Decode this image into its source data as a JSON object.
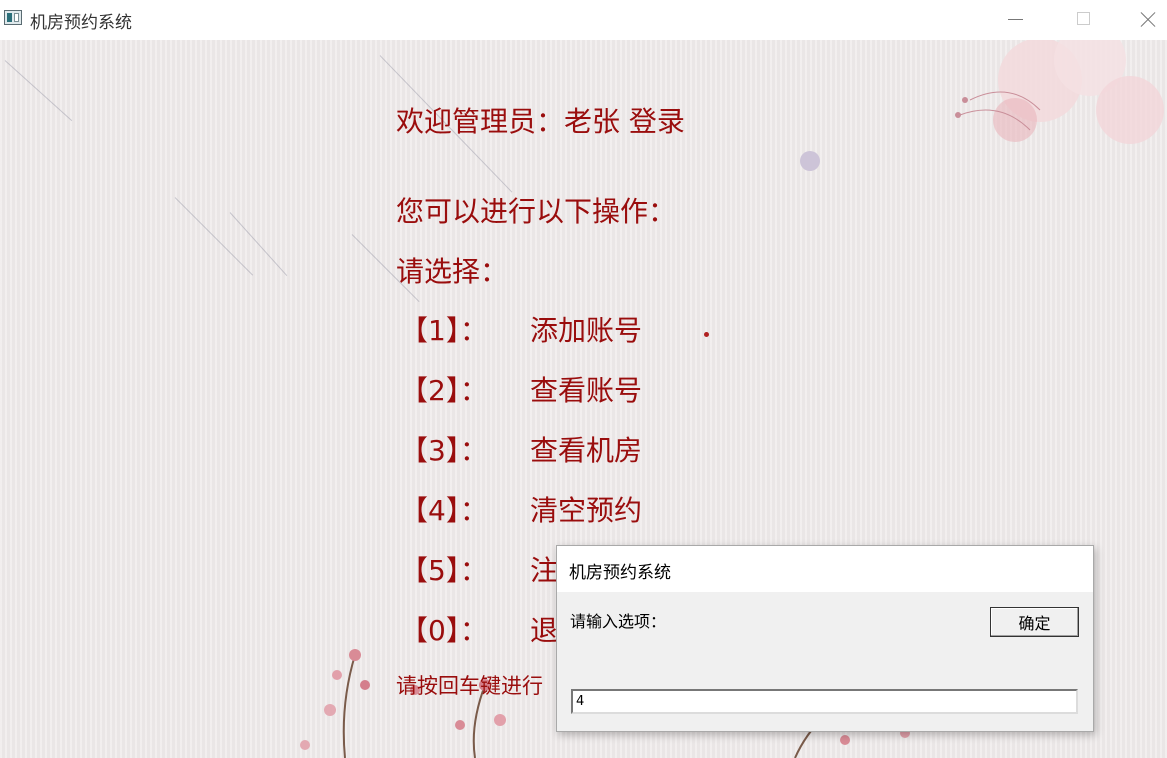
{
  "window": {
    "title": "机房预约系统",
    "icon": "app-window-icon",
    "controls": [
      "minimize-icon",
      "maximize-icon",
      "close-icon"
    ]
  },
  "welcome": "欢迎管理员：老张    登录",
  "operations_title": "您可以进行以下操作：",
  "select_prompt": "请选择：",
  "menu": [
    {
      "num": "【1】：",
      "label": "添加账号"
    },
    {
      "num": "【2】：",
      "label": "查看账号"
    },
    {
      "num": "【3】：",
      "label": "查看机房"
    },
    {
      "num": "【4】：",
      "label": "清空预约"
    },
    {
      "num": "【5】：",
      "label": "注"
    },
    {
      "num": "【0】：",
      "label": "退"
    }
  ],
  "hint": "请按回车键进行",
  "dialog": {
    "title": "机房预约系统",
    "prompt": "请输入选项：",
    "ok_label": "确定",
    "input_value": "4"
  },
  "colors": {
    "menu_text": "#9a0d0d",
    "background": "#eeeaea"
  }
}
